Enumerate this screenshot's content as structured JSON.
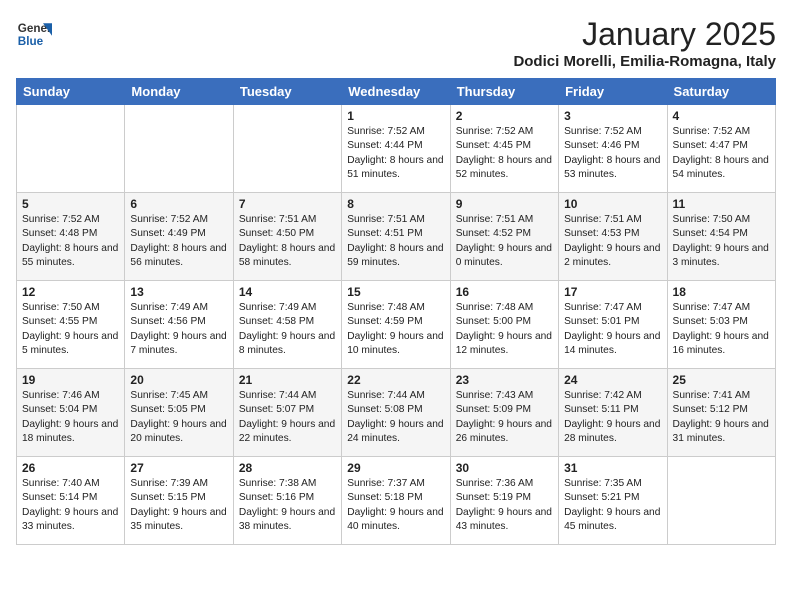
{
  "header": {
    "logo_general": "General",
    "logo_blue": "Blue",
    "month_title": "January 2025",
    "location": "Dodici Morelli, Emilia-Romagna, Italy"
  },
  "weekdays": [
    "Sunday",
    "Monday",
    "Tuesday",
    "Wednesday",
    "Thursday",
    "Friday",
    "Saturday"
  ],
  "weeks": [
    [
      {
        "day": "",
        "content": ""
      },
      {
        "day": "",
        "content": ""
      },
      {
        "day": "",
        "content": ""
      },
      {
        "day": "1",
        "content": "Sunrise: 7:52 AM\nSunset: 4:44 PM\nDaylight: 8 hours and 51 minutes."
      },
      {
        "day": "2",
        "content": "Sunrise: 7:52 AM\nSunset: 4:45 PM\nDaylight: 8 hours and 52 minutes."
      },
      {
        "day": "3",
        "content": "Sunrise: 7:52 AM\nSunset: 4:46 PM\nDaylight: 8 hours and 53 minutes."
      },
      {
        "day": "4",
        "content": "Sunrise: 7:52 AM\nSunset: 4:47 PM\nDaylight: 8 hours and 54 minutes."
      }
    ],
    [
      {
        "day": "5",
        "content": "Sunrise: 7:52 AM\nSunset: 4:48 PM\nDaylight: 8 hours and 55 minutes."
      },
      {
        "day": "6",
        "content": "Sunrise: 7:52 AM\nSunset: 4:49 PM\nDaylight: 8 hours and 56 minutes."
      },
      {
        "day": "7",
        "content": "Sunrise: 7:51 AM\nSunset: 4:50 PM\nDaylight: 8 hours and 58 minutes."
      },
      {
        "day": "8",
        "content": "Sunrise: 7:51 AM\nSunset: 4:51 PM\nDaylight: 8 hours and 59 minutes."
      },
      {
        "day": "9",
        "content": "Sunrise: 7:51 AM\nSunset: 4:52 PM\nDaylight: 9 hours and 0 minutes."
      },
      {
        "day": "10",
        "content": "Sunrise: 7:51 AM\nSunset: 4:53 PM\nDaylight: 9 hours and 2 minutes."
      },
      {
        "day": "11",
        "content": "Sunrise: 7:50 AM\nSunset: 4:54 PM\nDaylight: 9 hours and 3 minutes."
      }
    ],
    [
      {
        "day": "12",
        "content": "Sunrise: 7:50 AM\nSunset: 4:55 PM\nDaylight: 9 hours and 5 minutes."
      },
      {
        "day": "13",
        "content": "Sunrise: 7:49 AM\nSunset: 4:56 PM\nDaylight: 9 hours and 7 minutes."
      },
      {
        "day": "14",
        "content": "Sunrise: 7:49 AM\nSunset: 4:58 PM\nDaylight: 9 hours and 8 minutes."
      },
      {
        "day": "15",
        "content": "Sunrise: 7:48 AM\nSunset: 4:59 PM\nDaylight: 9 hours and 10 minutes."
      },
      {
        "day": "16",
        "content": "Sunrise: 7:48 AM\nSunset: 5:00 PM\nDaylight: 9 hours and 12 minutes."
      },
      {
        "day": "17",
        "content": "Sunrise: 7:47 AM\nSunset: 5:01 PM\nDaylight: 9 hours and 14 minutes."
      },
      {
        "day": "18",
        "content": "Sunrise: 7:47 AM\nSunset: 5:03 PM\nDaylight: 9 hours and 16 minutes."
      }
    ],
    [
      {
        "day": "19",
        "content": "Sunrise: 7:46 AM\nSunset: 5:04 PM\nDaylight: 9 hours and 18 minutes."
      },
      {
        "day": "20",
        "content": "Sunrise: 7:45 AM\nSunset: 5:05 PM\nDaylight: 9 hours and 20 minutes."
      },
      {
        "day": "21",
        "content": "Sunrise: 7:44 AM\nSunset: 5:07 PM\nDaylight: 9 hours and 22 minutes."
      },
      {
        "day": "22",
        "content": "Sunrise: 7:44 AM\nSunset: 5:08 PM\nDaylight: 9 hours and 24 minutes."
      },
      {
        "day": "23",
        "content": "Sunrise: 7:43 AM\nSunset: 5:09 PM\nDaylight: 9 hours and 26 minutes."
      },
      {
        "day": "24",
        "content": "Sunrise: 7:42 AM\nSunset: 5:11 PM\nDaylight: 9 hours and 28 minutes."
      },
      {
        "day": "25",
        "content": "Sunrise: 7:41 AM\nSunset: 5:12 PM\nDaylight: 9 hours and 31 minutes."
      }
    ],
    [
      {
        "day": "26",
        "content": "Sunrise: 7:40 AM\nSunset: 5:14 PM\nDaylight: 9 hours and 33 minutes."
      },
      {
        "day": "27",
        "content": "Sunrise: 7:39 AM\nSunset: 5:15 PM\nDaylight: 9 hours and 35 minutes."
      },
      {
        "day": "28",
        "content": "Sunrise: 7:38 AM\nSunset: 5:16 PM\nDaylight: 9 hours and 38 minutes."
      },
      {
        "day": "29",
        "content": "Sunrise: 7:37 AM\nSunset: 5:18 PM\nDaylight: 9 hours and 40 minutes."
      },
      {
        "day": "30",
        "content": "Sunrise: 7:36 AM\nSunset: 5:19 PM\nDaylight: 9 hours and 43 minutes."
      },
      {
        "day": "31",
        "content": "Sunrise: 7:35 AM\nSunset: 5:21 PM\nDaylight: 9 hours and 45 minutes."
      },
      {
        "day": "",
        "content": ""
      }
    ]
  ]
}
